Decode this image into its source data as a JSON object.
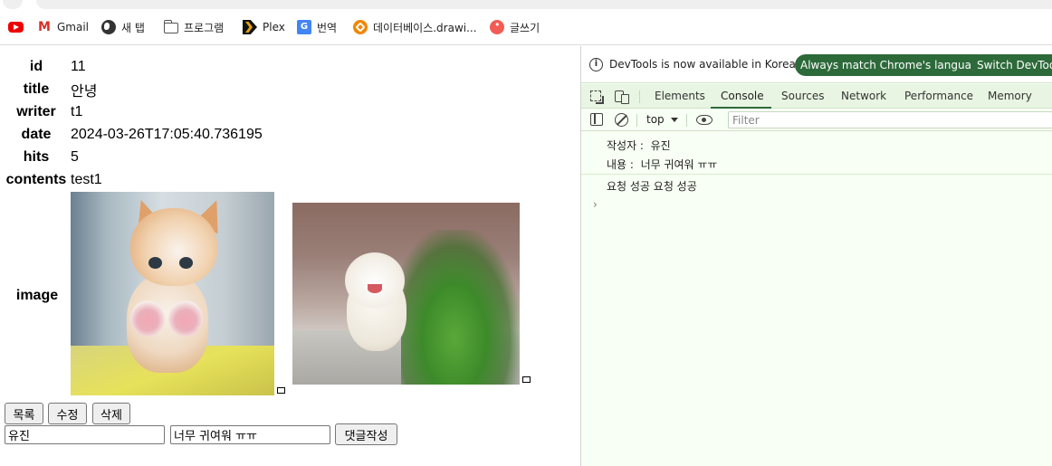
{
  "bookmarks": [
    {
      "label": "",
      "icon": "youtube-icon"
    },
    {
      "label": "Gmail",
      "icon": "gmail-icon"
    },
    {
      "label": "새 탭",
      "icon": "globe-icon"
    },
    {
      "label": "프로그램",
      "icon": "folder-icon"
    },
    {
      "label": "Plex",
      "icon": "plex-icon"
    },
    {
      "label": "번역",
      "icon": "google-translate-icon"
    },
    {
      "label": "데이터베이스.drawi...",
      "icon": "drawio-icon"
    },
    {
      "label": "글쓰기",
      "icon": "write-icon"
    }
  ],
  "detail": {
    "id_label": "id",
    "id_value": "11",
    "title_label": "title",
    "title_value": "안녕",
    "writer_label": "writer",
    "writer_value": "t1",
    "date_label": "date",
    "date_value": "2024-03-26T17:05:40.736195",
    "hits_label": "hits",
    "hits_value": "5",
    "contents_label": "contents",
    "contents_value": "test1",
    "image_label": "image"
  },
  "buttons": {
    "list": "목록",
    "edit": "수정",
    "delete": "삭제",
    "comment_submit": "댓글작성"
  },
  "comment_form": {
    "writer_value": "유진",
    "contents_value": "너무 귀여워 ㅠㅠ"
  },
  "devtools": {
    "info_message": "DevTools is now available in Korean!",
    "match_language": "Always match Chrome's language",
    "switch_devtools": "Switch DevTools",
    "tabs": [
      "Elements",
      "Console",
      "Sources",
      "Network",
      "Performance",
      "Memory"
    ],
    "active_tab": "Console",
    "context": "top",
    "filter_placeholder": "Filter",
    "console_lines": [
      "작성자 :  유진",
      "내용 :  너무 귀여워 ㅠㅠ",
      "요청 성공 요청 성공"
    ],
    "prompt_symbol": "›",
    "accent_color": "#2d6a3a"
  }
}
